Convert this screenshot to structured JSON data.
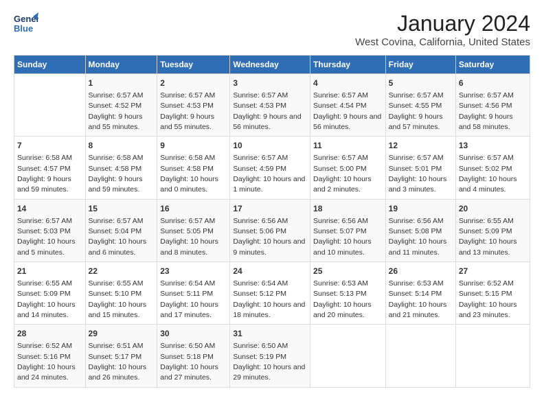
{
  "logo": {
    "line1": "General",
    "line2": "Blue"
  },
  "title": "January 2024",
  "subtitle": "West Covina, California, United States",
  "days_header": [
    "Sunday",
    "Monday",
    "Tuesday",
    "Wednesday",
    "Thursday",
    "Friday",
    "Saturday"
  ],
  "weeks": [
    [
      {
        "day": "",
        "sunrise": "",
        "sunset": "",
        "daylight": ""
      },
      {
        "day": "1",
        "sunrise": "Sunrise: 6:57 AM",
        "sunset": "Sunset: 4:52 PM",
        "daylight": "Daylight: 9 hours and 55 minutes."
      },
      {
        "day": "2",
        "sunrise": "Sunrise: 6:57 AM",
        "sunset": "Sunset: 4:53 PM",
        "daylight": "Daylight: 9 hours and 55 minutes."
      },
      {
        "day": "3",
        "sunrise": "Sunrise: 6:57 AM",
        "sunset": "Sunset: 4:53 PM",
        "daylight": "Daylight: 9 hours and 56 minutes."
      },
      {
        "day": "4",
        "sunrise": "Sunrise: 6:57 AM",
        "sunset": "Sunset: 4:54 PM",
        "daylight": "Daylight: 9 hours and 56 minutes."
      },
      {
        "day": "5",
        "sunrise": "Sunrise: 6:57 AM",
        "sunset": "Sunset: 4:55 PM",
        "daylight": "Daylight: 9 hours and 57 minutes."
      },
      {
        "day": "6",
        "sunrise": "Sunrise: 6:57 AM",
        "sunset": "Sunset: 4:56 PM",
        "daylight": "Daylight: 9 hours and 58 minutes."
      }
    ],
    [
      {
        "day": "7",
        "sunrise": "Sunrise: 6:58 AM",
        "sunset": "Sunset: 4:57 PM",
        "daylight": "Daylight: 9 hours and 59 minutes."
      },
      {
        "day": "8",
        "sunrise": "Sunrise: 6:58 AM",
        "sunset": "Sunset: 4:58 PM",
        "daylight": "Daylight: 9 hours and 59 minutes."
      },
      {
        "day": "9",
        "sunrise": "Sunrise: 6:58 AM",
        "sunset": "Sunset: 4:58 PM",
        "daylight": "Daylight: 10 hours and 0 minutes."
      },
      {
        "day": "10",
        "sunrise": "Sunrise: 6:57 AM",
        "sunset": "Sunset: 4:59 PM",
        "daylight": "Daylight: 10 hours and 1 minute."
      },
      {
        "day": "11",
        "sunrise": "Sunrise: 6:57 AM",
        "sunset": "Sunset: 5:00 PM",
        "daylight": "Daylight: 10 hours and 2 minutes."
      },
      {
        "day": "12",
        "sunrise": "Sunrise: 6:57 AM",
        "sunset": "Sunset: 5:01 PM",
        "daylight": "Daylight: 10 hours and 3 minutes."
      },
      {
        "day": "13",
        "sunrise": "Sunrise: 6:57 AM",
        "sunset": "Sunset: 5:02 PM",
        "daylight": "Daylight: 10 hours and 4 minutes."
      }
    ],
    [
      {
        "day": "14",
        "sunrise": "Sunrise: 6:57 AM",
        "sunset": "Sunset: 5:03 PM",
        "daylight": "Daylight: 10 hours and 5 minutes."
      },
      {
        "day": "15",
        "sunrise": "Sunrise: 6:57 AM",
        "sunset": "Sunset: 5:04 PM",
        "daylight": "Daylight: 10 hours and 6 minutes."
      },
      {
        "day": "16",
        "sunrise": "Sunrise: 6:57 AM",
        "sunset": "Sunset: 5:05 PM",
        "daylight": "Daylight: 10 hours and 8 minutes."
      },
      {
        "day": "17",
        "sunrise": "Sunrise: 6:56 AM",
        "sunset": "Sunset: 5:06 PM",
        "daylight": "Daylight: 10 hours and 9 minutes."
      },
      {
        "day": "18",
        "sunrise": "Sunrise: 6:56 AM",
        "sunset": "Sunset: 5:07 PM",
        "daylight": "Daylight: 10 hours and 10 minutes."
      },
      {
        "day": "19",
        "sunrise": "Sunrise: 6:56 AM",
        "sunset": "Sunset: 5:08 PM",
        "daylight": "Daylight: 10 hours and 11 minutes."
      },
      {
        "day": "20",
        "sunrise": "Sunrise: 6:55 AM",
        "sunset": "Sunset: 5:09 PM",
        "daylight": "Daylight: 10 hours and 13 minutes."
      }
    ],
    [
      {
        "day": "21",
        "sunrise": "Sunrise: 6:55 AM",
        "sunset": "Sunset: 5:09 PM",
        "daylight": "Daylight: 10 hours and 14 minutes."
      },
      {
        "day": "22",
        "sunrise": "Sunrise: 6:55 AM",
        "sunset": "Sunset: 5:10 PM",
        "daylight": "Daylight: 10 hours and 15 minutes."
      },
      {
        "day": "23",
        "sunrise": "Sunrise: 6:54 AM",
        "sunset": "Sunset: 5:11 PM",
        "daylight": "Daylight: 10 hours and 17 minutes."
      },
      {
        "day": "24",
        "sunrise": "Sunrise: 6:54 AM",
        "sunset": "Sunset: 5:12 PM",
        "daylight": "Daylight: 10 hours and 18 minutes."
      },
      {
        "day": "25",
        "sunrise": "Sunrise: 6:53 AM",
        "sunset": "Sunset: 5:13 PM",
        "daylight": "Daylight: 10 hours and 20 minutes."
      },
      {
        "day": "26",
        "sunrise": "Sunrise: 6:53 AM",
        "sunset": "Sunset: 5:14 PM",
        "daylight": "Daylight: 10 hours and 21 minutes."
      },
      {
        "day": "27",
        "sunrise": "Sunrise: 6:52 AM",
        "sunset": "Sunset: 5:15 PM",
        "daylight": "Daylight: 10 hours and 23 minutes."
      }
    ],
    [
      {
        "day": "28",
        "sunrise": "Sunrise: 6:52 AM",
        "sunset": "Sunset: 5:16 PM",
        "daylight": "Daylight: 10 hours and 24 minutes."
      },
      {
        "day": "29",
        "sunrise": "Sunrise: 6:51 AM",
        "sunset": "Sunset: 5:17 PM",
        "daylight": "Daylight: 10 hours and 26 minutes."
      },
      {
        "day": "30",
        "sunrise": "Sunrise: 6:50 AM",
        "sunset": "Sunset: 5:18 PM",
        "daylight": "Daylight: 10 hours and 27 minutes."
      },
      {
        "day": "31",
        "sunrise": "Sunrise: 6:50 AM",
        "sunset": "Sunset: 5:19 PM",
        "daylight": "Daylight: 10 hours and 29 minutes."
      },
      {
        "day": "",
        "sunrise": "",
        "sunset": "",
        "daylight": ""
      },
      {
        "day": "",
        "sunrise": "",
        "sunset": "",
        "daylight": ""
      },
      {
        "day": "",
        "sunrise": "",
        "sunset": "",
        "daylight": ""
      }
    ]
  ]
}
